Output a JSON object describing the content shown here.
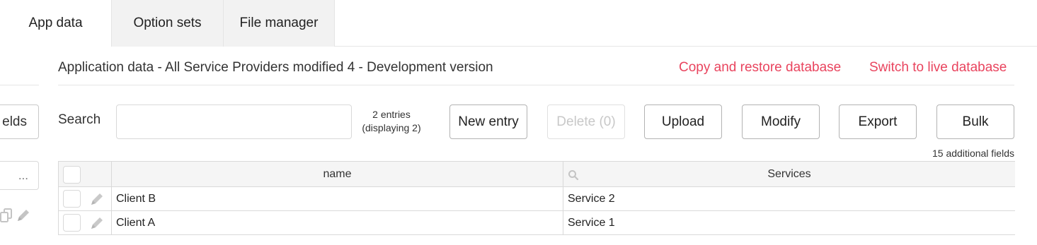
{
  "tabs": [
    {
      "label": "App data",
      "active": true
    },
    {
      "label": "Option sets",
      "active": false
    },
    {
      "label": "File manager",
      "active": false
    }
  ],
  "sidebar": {
    "fields_button_label": "elds",
    "input_value": "..."
  },
  "header": {
    "title": "Application data - All Service Providers modified 4 - Development version",
    "copy_restore_link": "Copy and restore database",
    "switch_live_link": "Switch to live database"
  },
  "toolbar": {
    "search_label": "Search",
    "search_value": "",
    "entries_count": "2 entries",
    "entries_displaying": "(displaying 2)",
    "new_entry": "New entry",
    "delete": "Delete (0)",
    "upload": "Upload",
    "modify": "Modify",
    "export": "Export",
    "bulk": "Bulk",
    "additional_fields": "15 additional fields"
  },
  "table": {
    "columns": [
      "name",
      "Services"
    ],
    "rows": [
      {
        "name": "Client B",
        "services": "Service 2"
      },
      {
        "name": "Client A",
        "services": "Service 1"
      }
    ]
  },
  "colors": {
    "link": "#e9445e",
    "border": "#d9d9d9",
    "header_bg": "#f5f5f5",
    "tab_inactive_bg": "#f2f2f2"
  },
  "icons": [
    "copy-icon",
    "pencil-icon",
    "search-icon",
    "edit-icon"
  ]
}
